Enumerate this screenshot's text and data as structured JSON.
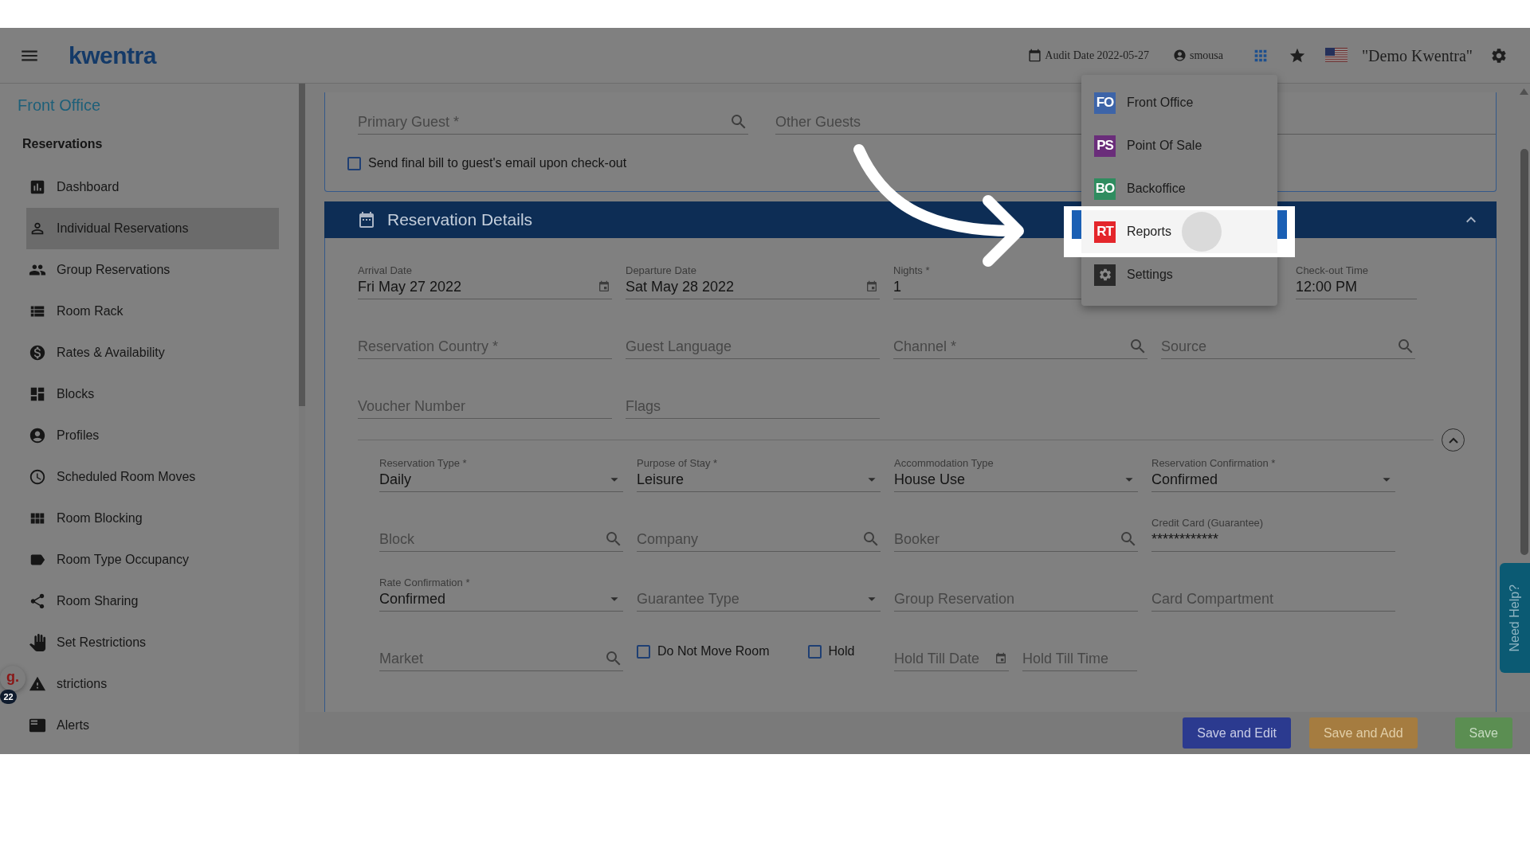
{
  "header": {
    "logo": "kwentra",
    "audit_date": "Audit Date 2022-05-27",
    "user": "smousa",
    "hotel": "\"Demo Kwentra\""
  },
  "sidebar": {
    "title": "Front Office",
    "section": "Reservations",
    "items": [
      {
        "label": "Dashboard",
        "selected": false
      },
      {
        "label": "Individual Reservations",
        "selected": true
      },
      {
        "label": "Group Reservations",
        "selected": false
      },
      {
        "label": "Room Rack",
        "selected": false
      },
      {
        "label": "Rates & Availability",
        "selected": false
      },
      {
        "label": "Blocks",
        "selected": false
      },
      {
        "label": "Profiles",
        "selected": false
      },
      {
        "label": "Scheduled Room Moves",
        "selected": false
      },
      {
        "label": "Room Blocking",
        "selected": false
      },
      {
        "label": "Room Type Occupancy",
        "selected": false
      },
      {
        "label": "Room Sharing",
        "selected": false
      },
      {
        "label": "Set Restrictions",
        "selected": false
      },
      {
        "label": "strictions",
        "selected": false
      },
      {
        "label": "Alerts",
        "selected": false
      }
    ]
  },
  "widget": {
    "logo": "g.",
    "count": "22"
  },
  "guest_card": {
    "fields": [
      {
        "kind": "search",
        "placeholder": "Primary Guest *"
      },
      {
        "kind": "text",
        "placeholder": "Other Guests"
      }
    ],
    "checkbox": {
      "label": "Send final bill to guest's email upon check-out",
      "checked": false
    }
  },
  "details": {
    "title": "Reservation Details",
    "expanded": true,
    "sections": [
      {
        "rows": [
          [
            {
              "kind": "date",
              "label": "Arrival Date",
              "value": "Fri May 27 2022"
            },
            {
              "kind": "date",
              "label": "Departure Date",
              "value": "Sat May 28 2022"
            },
            {
              "kind": "text",
              "label": "Nights *",
              "value": "1"
            },
            {
              "kind": "time",
              "label": "Check-out Time",
              "value": "12:00 PM"
            }
          ],
          [
            {
              "kind": "text",
              "placeholder": "Reservation Country *"
            },
            {
              "kind": "text",
              "placeholder": "Guest Language"
            },
            {
              "kind": "search",
              "placeholder": "Channel *"
            },
            {
              "kind": "search",
              "placeholder": "Source"
            }
          ],
          [
            {
              "kind": "text",
              "placeholder": "Voucher Number"
            },
            {
              "kind": "text",
              "placeholder": "Flags"
            }
          ]
        ]
      },
      {
        "expanded": true,
        "rows": [
          [
            {
              "kind": "select",
              "label": "Reservation Type *",
              "value": "Daily"
            },
            {
              "kind": "select",
              "label": "Purpose of Stay *",
              "value": "Leisure"
            },
            {
              "kind": "select",
              "label": "Accommodation Type",
              "value": "House Use"
            },
            {
              "kind": "select",
              "label": "Reservation Confirmation *",
              "value": "Confirmed"
            }
          ],
          [
            {
              "kind": "search",
              "placeholder": "Block"
            },
            {
              "kind": "search",
              "placeholder": "Company"
            },
            {
              "kind": "search",
              "placeholder": "Booker"
            },
            {
              "kind": "text",
              "label": "Credit Card (Guarantee)",
              "value": "************"
            }
          ],
          [
            {
              "kind": "select",
              "label": "Rate Confirmation *",
              "value": "Confirmed"
            },
            {
              "kind": "select",
              "placeholder": "Guarantee Type"
            },
            {
              "kind": "text",
              "placeholder": "Group Reservation"
            },
            {
              "kind": "text",
              "placeholder": "Card Compartment"
            }
          ],
          [
            {
              "kind": "search",
              "placeholder": "Market"
            },
            {
              "kind": "checkboxes",
              "options": [
                {
                  "label": "Do Not Move Room",
                  "checked": false
                },
                {
                  "label": "Hold",
                  "checked": false
                }
              ]
            },
            {
              "kind": "pair",
              "fields": [
                {
                  "kind": "date",
                  "placeholder": "Hold Till Date"
                },
                {
                  "kind": "text",
                  "placeholder": "Hold Till Time"
                }
              ]
            }
          ]
        ]
      }
    ]
  },
  "buttons": [
    {
      "label": "Save and Edit",
      "kind": "primary"
    },
    {
      "label": "Save and Add",
      "kind": "secondary"
    },
    {
      "label": "Save",
      "kind": "success"
    }
  ],
  "app_menu": {
    "items": [
      {
        "badge": "FO",
        "label": "Front Office",
        "color": "#3d64a8",
        "selected": false
      },
      {
        "badge": "PS",
        "label": "Point Of Sale",
        "color": "#6a2d7a",
        "selected": false
      },
      {
        "badge": "BO",
        "label": "Backoffice",
        "color": "#2f8c5f",
        "selected": false
      },
      {
        "badge": "RT",
        "label": "Reports",
        "color": "#e4262b",
        "selected": true
      },
      {
        "label": "Settings",
        "selected": false
      }
    ]
  },
  "help_tab": "Need Help?"
}
